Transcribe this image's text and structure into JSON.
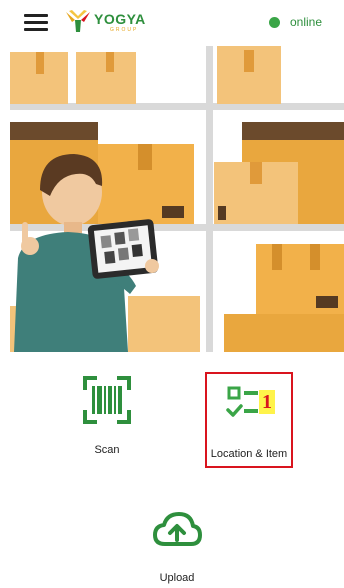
{
  "header": {
    "logo_text": "YOGYA",
    "logo_sub": "GROUP",
    "status_text": "online",
    "status_color": "#3aa547"
  },
  "actions": {
    "scan_label": "Scan",
    "location_label": "Location & Item",
    "location_marker": "1",
    "upload_label": "Upload"
  },
  "icons": {
    "menu": "hamburger-menu-icon",
    "scan": "barcode-scan-icon",
    "location": "checklist-icon",
    "upload": "cloud-upload-icon"
  },
  "colors": {
    "brand_green": "#2e8f3d",
    "icon_green": "#3aa547",
    "highlight_red": "#d9141e",
    "marker_yellow": "#fff34a"
  }
}
